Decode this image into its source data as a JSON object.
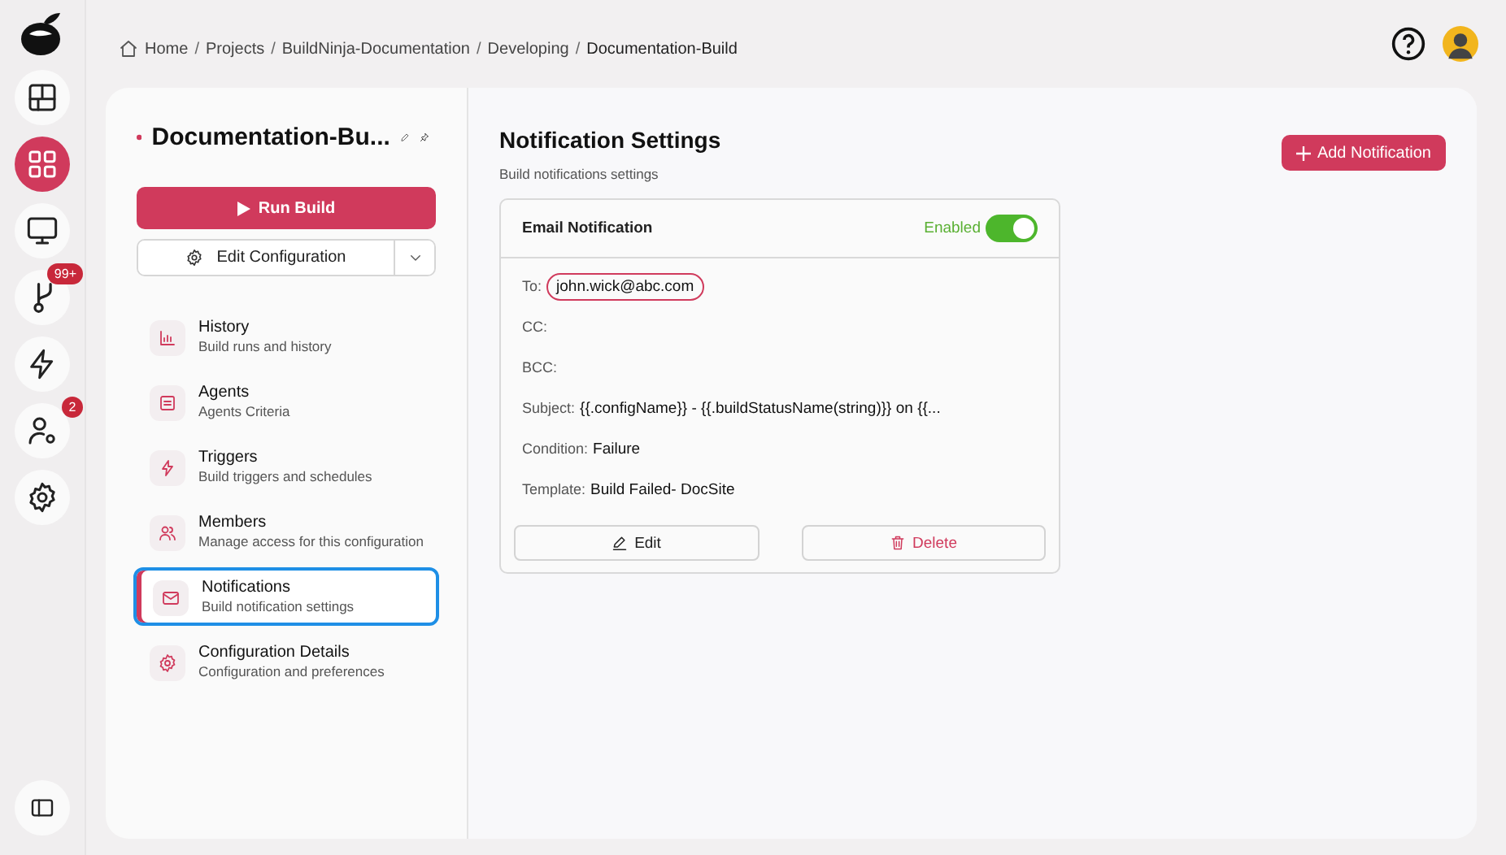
{
  "rail": {
    "items": [
      {
        "selected": false
      },
      {
        "selected": true
      },
      {
        "selected": false
      },
      {
        "selected": false,
        "badge": "99+"
      },
      {
        "selected": false
      },
      {
        "selected": false,
        "badge": "2"
      },
      {
        "selected": false
      }
    ]
  },
  "breadcrumb": {
    "separator": "/",
    "items": [
      "Home",
      "Projects",
      "BuildNinja-Documentation",
      "Developing",
      "Documentation-Build"
    ]
  },
  "sidebar": {
    "title": "Documentation-Bu...",
    "run_button": "Run Build",
    "config_button": "Edit Configuration",
    "items": [
      {
        "label": "History",
        "description": "Build runs and history",
        "selected": false
      },
      {
        "label": "Agents",
        "description": "Agents Criteria",
        "selected": false
      },
      {
        "label": "Triggers",
        "description": "Build triggers and schedules",
        "selected": false
      },
      {
        "label": "Members",
        "description": "Manage access for this configuration",
        "selected": false
      },
      {
        "label": "Notifications",
        "description": "Build notification settings",
        "selected": true
      },
      {
        "label": "Configuration Details",
        "description": "Configuration and preferences",
        "selected": false
      }
    ]
  },
  "content": {
    "title": "Notification Settings",
    "subtitle": "Build notifications settings",
    "add_button": "Add Notification",
    "card": {
      "title": "Email Notification",
      "status": "Enabled",
      "on": true,
      "fields": [
        {
          "label": "To:",
          "value": "john.wick@abc.com",
          "kind": "chip"
        },
        {
          "label": "CC:",
          "kind": "text"
        },
        {
          "label": "BCC:",
          "kind": "text"
        },
        {
          "label": "Subject:",
          "value": "{{.configName}} - {{.buildStatusName(string)}} on {{...",
          "kind": "text"
        },
        {
          "label": "Condition:",
          "value": "Failure",
          "kind": "text"
        },
        {
          "label": "Template:",
          "value": "Build Failed- DocSite",
          "kind": "text"
        }
      ],
      "edit_button": "Edit",
      "delete_button": "Delete"
    }
  }
}
